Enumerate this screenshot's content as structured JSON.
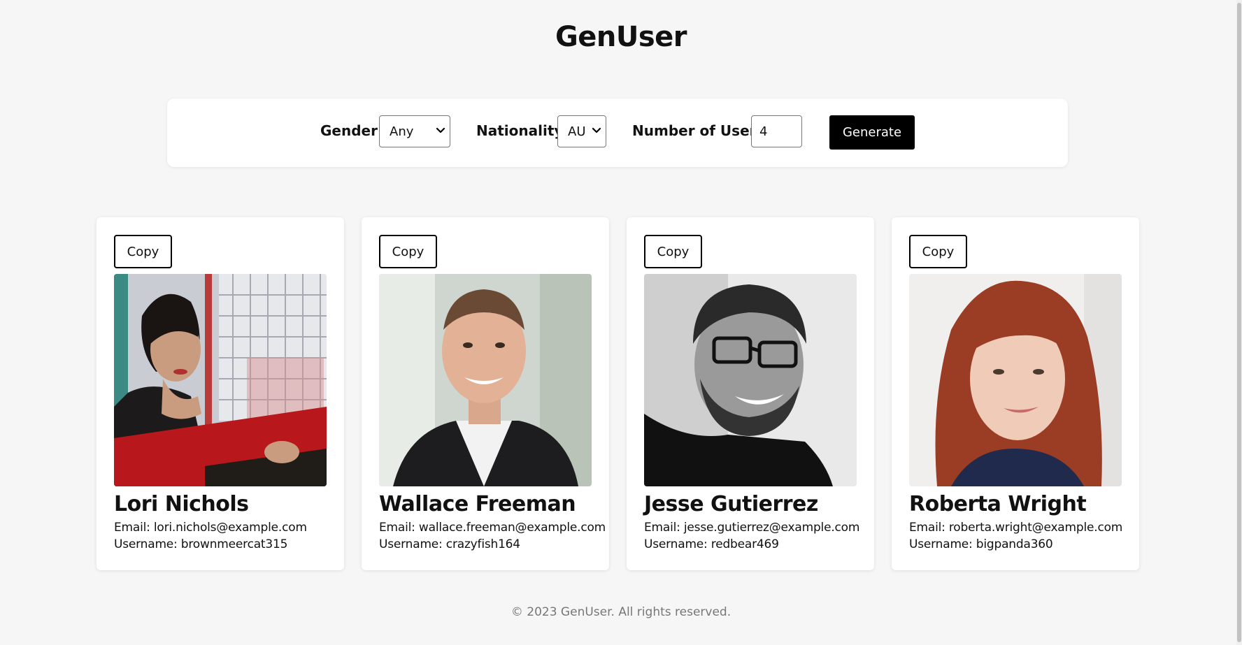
{
  "app": {
    "title": "GenUser"
  },
  "controls": {
    "gender_label": "Gender:",
    "gender_value": "Any",
    "nationality_label": "Nationality:",
    "nationality_value": "AU",
    "count_label": "Number of Users:",
    "count_value": "4",
    "generate_label": "Generate"
  },
  "cards": [
    {
      "copy_label": "Copy",
      "name": "Lori Nichols",
      "email": "Email: lori.nichols@example.com",
      "username": "Username: brownmeercat315"
    },
    {
      "copy_label": "Copy",
      "name": "Wallace Freeman",
      "email": "Email: wallace.freeman@example.com",
      "username": "Username: crazyfish164"
    },
    {
      "copy_label": "Copy",
      "name": "Jesse Gutierrez",
      "email": "Email: jesse.gutierrez@example.com",
      "username": "Username: redbear469"
    },
    {
      "copy_label": "Copy",
      "name": "Roberta Wright",
      "email": "Email: roberta.wright@example.com",
      "username": "Username: bigpanda360"
    }
  ],
  "footer": {
    "text": "© 2023 GenUser. All rights reserved."
  },
  "colors": {
    "background": "#f6f6f6",
    "card": "#ffffff",
    "accent": "#000000",
    "footer_text": "#777777"
  }
}
